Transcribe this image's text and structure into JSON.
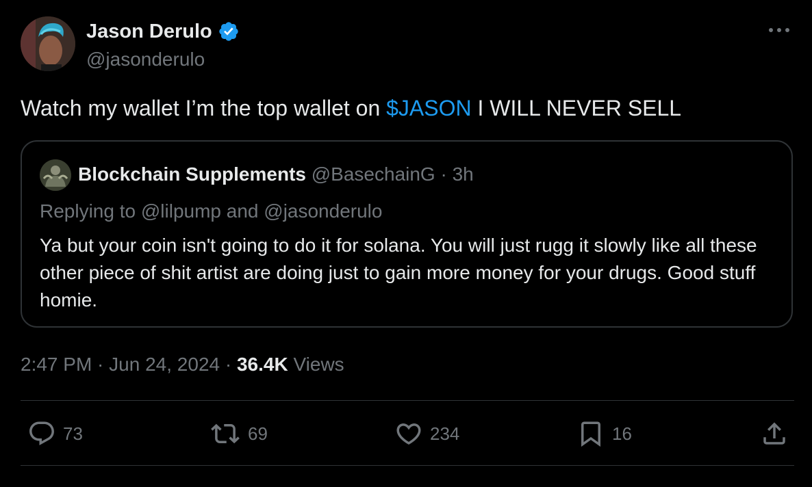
{
  "author": {
    "name": "Jason Derulo",
    "handle": "@jasonderulo",
    "verified_icon": "verified-badge-icon",
    "verified_color": "#1d9bf0"
  },
  "tweet": {
    "text_before": "Watch my wallet I’m the top wallet on ",
    "cashtag": "$JASON",
    "text_after": " I WILL NEVER SELL"
  },
  "quoted": {
    "name": "Blockchain Supplements",
    "handle": "@BasechainG",
    "separator": " · ",
    "age": "3h",
    "replying_to": "Replying to @lilpump and @jasonderulo",
    "body": "Ya but your coin isn't going to do it for solana. You will just rugg it slowly like all these other piece of shit artist are doing just to gain more money for your drugs. Good stuff homie."
  },
  "meta": {
    "time": "2:47 PM",
    "sep1": " · ",
    "date": "Jun 24, 2024",
    "sep2": " · ",
    "views_count": "36.4K",
    "views_label": " Views"
  },
  "actions": {
    "replies": "73",
    "reposts": "69",
    "likes": "234",
    "bookmarks": "16"
  },
  "colors": {
    "background": "#000000",
    "text": "#e7e9ea",
    "muted": "#71767b",
    "accent": "#1d9bf0",
    "border": "#2f3336"
  }
}
